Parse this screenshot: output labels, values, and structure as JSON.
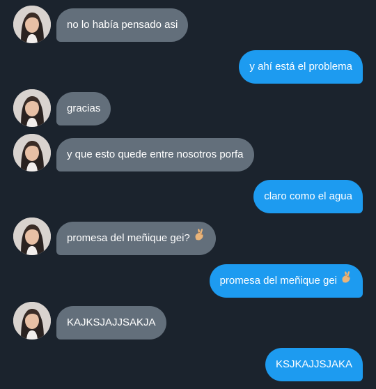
{
  "messages": [
    {
      "direction": "incoming",
      "text": "no lo había pensado asi",
      "has_emoji": false
    },
    {
      "direction": "outgoing",
      "text": "y ahí está el problema",
      "has_emoji": false
    },
    {
      "direction": "incoming",
      "text": "gracias",
      "has_emoji": false
    },
    {
      "direction": "incoming",
      "text": "y que esto quede entre nosotros porfa",
      "has_emoji": false
    },
    {
      "direction": "outgoing",
      "text": "claro como el agua",
      "has_emoji": false
    },
    {
      "direction": "incoming",
      "text": "promesa del meñique gei?",
      "has_emoji": true,
      "emoji": "crossed-fingers-icon"
    },
    {
      "direction": "outgoing",
      "text": "promesa del meñique gei",
      "has_emoji": true,
      "emoji": "crossed-fingers-icon"
    },
    {
      "direction": "incoming",
      "text": "KAJKSJAJJSAKJA",
      "has_emoji": false
    },
    {
      "direction": "outgoing",
      "text": "KSJKAJJSJAKA",
      "has_emoji": false
    }
  ],
  "colors": {
    "background": "#1b232d",
    "incoming_bubble": "#636f7b",
    "outgoing_bubble": "#1d9bf0",
    "text": "#ffffff"
  }
}
